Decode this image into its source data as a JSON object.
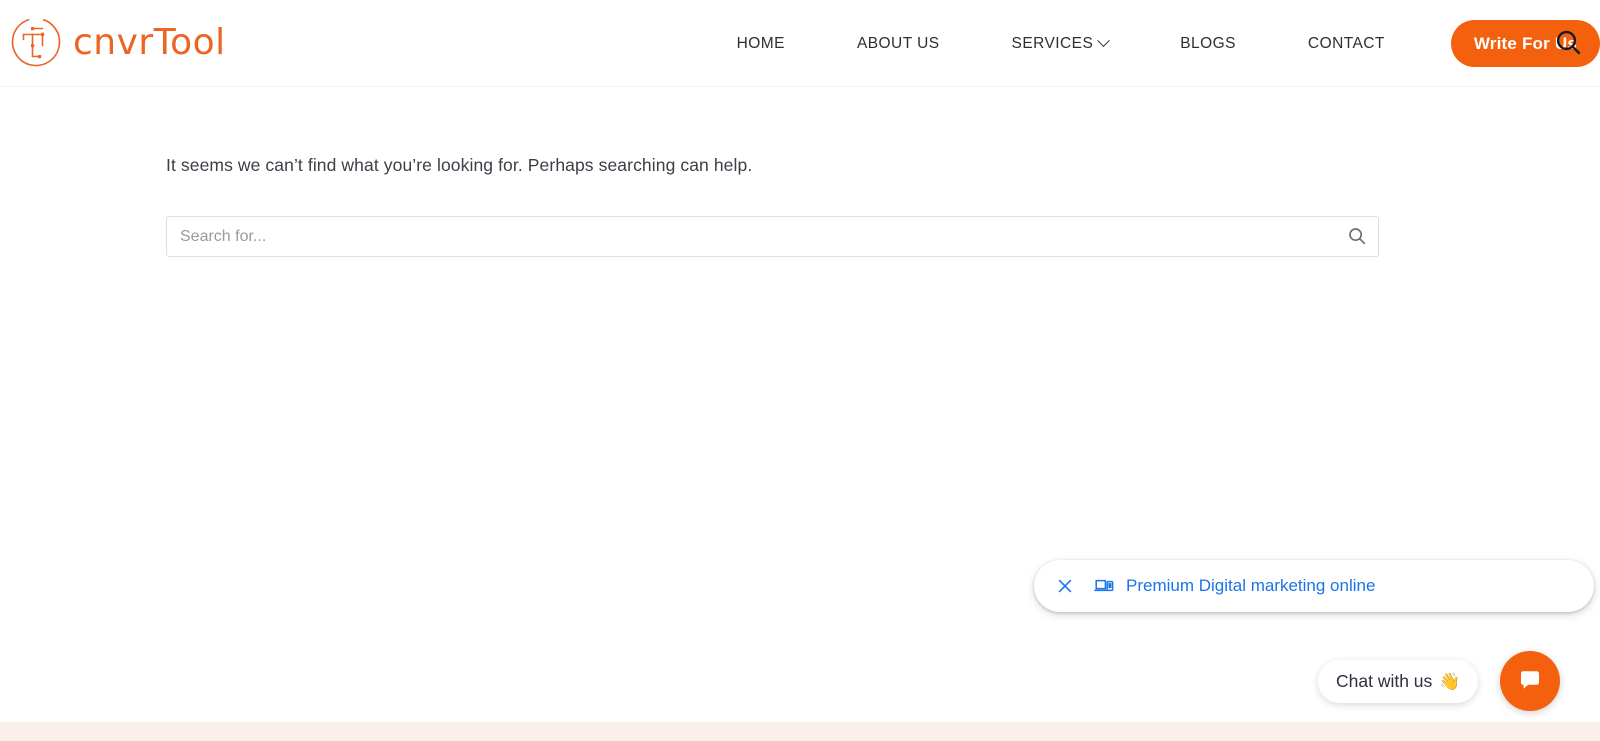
{
  "header": {
    "brand": {
      "name": "cnvrTool",
      "logo_icon": "circuit-t-logo-icon",
      "color": "#ec6524"
    },
    "nav": [
      {
        "label": "HOME",
        "has_dropdown": false
      },
      {
        "label": "ABOUT US",
        "has_dropdown": false
      },
      {
        "label": "SERVICES",
        "has_dropdown": true
      },
      {
        "label": "BLOGS",
        "has_dropdown": false
      },
      {
        "label": "CONTACT",
        "has_dropdown": false
      }
    ],
    "cta": {
      "label": "Write For Us",
      "color": "#f4610e"
    },
    "search_icon": "search-icon"
  },
  "main": {
    "message": "It seems we can’t find what you’re looking for. Perhaps searching can help.",
    "search": {
      "placeholder": "Search for...",
      "value": "",
      "submit_icon": "search-icon"
    }
  },
  "cast_toast": {
    "close_icon": "close-icon",
    "device_icon": "cast-devices-icon",
    "label": "Premium Digital marketing online",
    "color": "#1a73e8"
  },
  "chat": {
    "bubble_text": "Chat with us",
    "bubble_emoji": "👋",
    "launcher_icon": "chat-message-icon",
    "launcher_color": "#f4610e"
  },
  "footer": {
    "band_color": "#fbefe9"
  }
}
